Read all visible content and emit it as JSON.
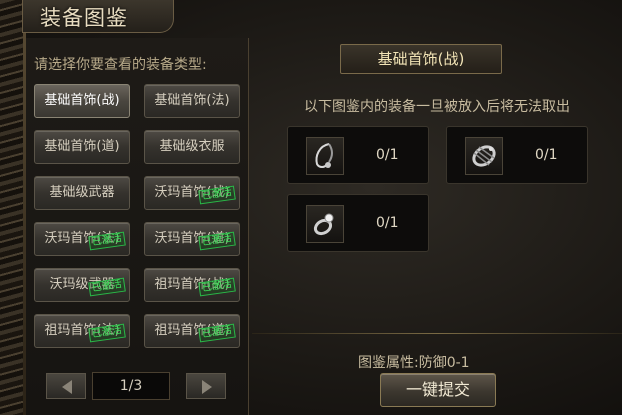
{
  "window": {
    "title": "装备图鉴"
  },
  "left_panel": {
    "prompt": "请选择你要查看的装备类型:",
    "categories": [
      {
        "label": "基础首饰(战)",
        "stamp": ""
      },
      {
        "label": "基础首饰(法)",
        "stamp": ""
      },
      {
        "label": "基础首饰(道)",
        "stamp": ""
      },
      {
        "label": "基础级衣服",
        "stamp": ""
      },
      {
        "label": "基础级武器",
        "stamp": ""
      },
      {
        "label": "沃玛首饰(战)",
        "stamp": "已激活"
      },
      {
        "label": "沃玛首饰(法)",
        "stamp": "已激活"
      },
      {
        "label": "沃玛首饰(道)",
        "stamp": "已激活"
      },
      {
        "label": "沃玛级武器",
        "stamp": "已激活"
      },
      {
        "label": "祖玛首饰(战)",
        "stamp": "已激活"
      },
      {
        "label": "祖玛首饰(法)",
        "stamp": "已激活"
      },
      {
        "label": "祖玛首饰(道)",
        "stamp": "已激活"
      }
    ],
    "pager": {
      "page_text": "1/3"
    }
  },
  "right_panel": {
    "title": "基础首饰(战)",
    "notice": "以下图鉴内的装备一旦被放入后将无法取出",
    "slots": [
      {
        "icon": "necklace-icon",
        "count": "0/1"
      },
      {
        "icon": "bracelet-icon",
        "count": "0/1"
      },
      {
        "icon": "ring-icon",
        "count": "0/1"
      }
    ],
    "attribute": "图鉴属性:防御0-1",
    "submit_label": "一键提交"
  }
}
